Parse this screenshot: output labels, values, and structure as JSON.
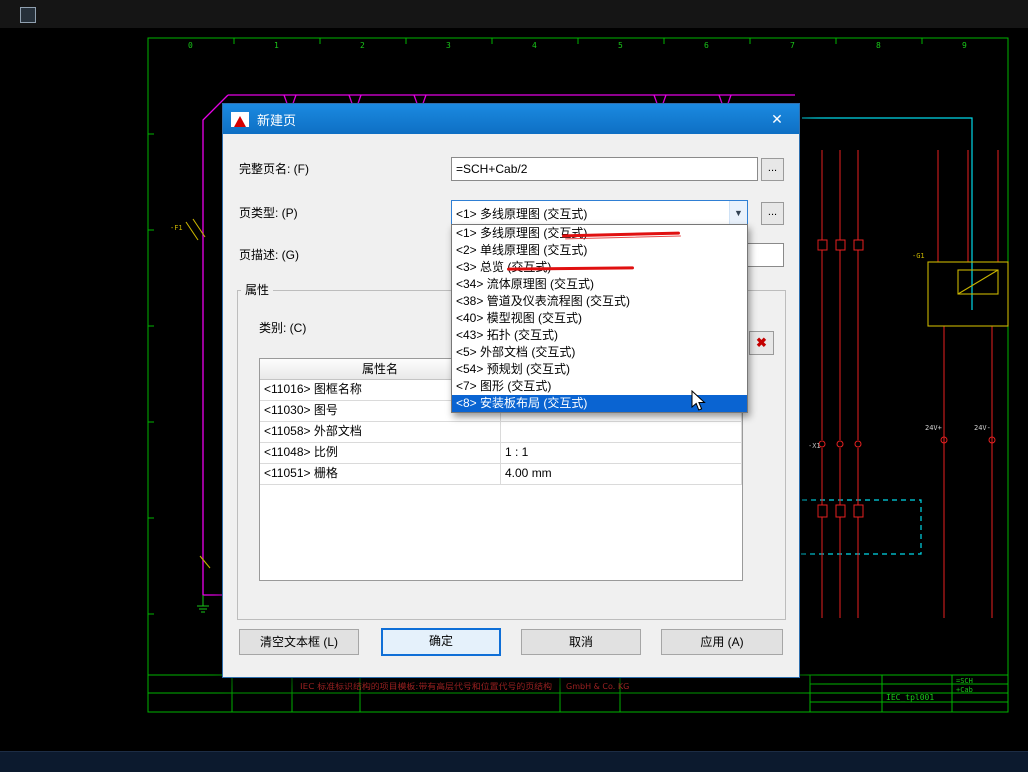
{
  "colors": {
    "title_bar": "#0f7bd7",
    "selection_highlight": "#0a64d2",
    "annotation_red": "#e01010",
    "canvas_green": "#19c819",
    "canvas_magenta": "#f000f0",
    "canvas_cyan": "#00d8e8",
    "canvas_red": "#e82020",
    "canvas_yellow": "#c8b400"
  },
  "icons": {
    "close": "✕",
    "chevron_down": "▼",
    "delete": "✖",
    "browse": "..."
  },
  "dialog": {
    "title": "新建页",
    "full_page_name": {
      "label": "完整页名: (F)",
      "value": "=SCH+Cab/2"
    },
    "page_type": {
      "label": "页类型: (P)",
      "value": "<1> 多线原理图 (交互式)"
    },
    "page_desc": {
      "label": "页描述: (G)",
      "value": ""
    },
    "dropdown": {
      "items": [
        {
          "label": "<1> 多线原理图 (交互式)"
        },
        {
          "label": "<2> 单线原理图 (交互式)"
        },
        {
          "label": "<3> 总览 (交互式)"
        },
        {
          "label": "<34> 流体原理图 (交互式)"
        },
        {
          "label": "<38> 管道及仪表流程图 (交互式)"
        },
        {
          "label": "<40> 模型视图 (交互式)"
        },
        {
          "label": "<43> 拓扑 (交互式)"
        },
        {
          "label": "<5> 外部文档 (交互式)"
        },
        {
          "label": "<54> 预规划 (交互式)"
        },
        {
          "label": "<7> 图形 (交互式)"
        },
        {
          "label": "<8> 安装板布局 (交互式)"
        }
      ],
      "selected_index": 10
    },
    "properties": {
      "group_title": "属性",
      "category_label": "类别: (C)",
      "table": {
        "headers": [
          "属性名",
          ""
        ],
        "rows": [
          {
            "name": "<11016> 图框名称",
            "value": ""
          },
          {
            "name": "<11030> 图号",
            "value": ""
          },
          {
            "name": "<11058> 外部文档",
            "value": ""
          },
          {
            "name": "<11048> 比例",
            "value": "1 : 1"
          },
          {
            "name": "<11051> 栅格",
            "value": "4.00 mm"
          }
        ]
      }
    },
    "buttons": {
      "clear": "清空文本框 (L)",
      "ok": "确定",
      "cancel": "取消",
      "apply": "应用 (A)"
    }
  },
  "canvas": {
    "column_labels": [
      "0",
      "1",
      "2",
      "3",
      "4",
      "5",
      "6",
      "7",
      "8",
      "9"
    ],
    "labels": {
      "f1": "-F1",
      "g1": "-G1",
      "x1": "-X1",
      "v_plus": "24V+",
      "v_minus": "24V-",
      "company": "GmbH & Co. KG",
      "template_desc": "IEC 标准标识结构的项目模板:带有高层代号和位置代号的页结构",
      "template_id": "IEC_tpl001",
      "sch": "=SCH",
      "cab": "+Cab"
    }
  }
}
